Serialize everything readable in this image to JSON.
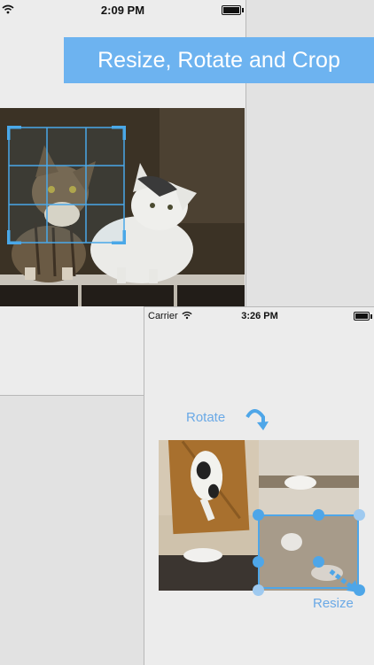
{
  "top_phone": {
    "status_bar": {
      "time": "2:09 PM"
    },
    "banner": {
      "text": "Resize, Rotate and Crop"
    }
  },
  "bottom_phone": {
    "status_bar": {
      "carrier": "Carrier",
      "time": "3:26 PM"
    },
    "rotate_label": "Rotate",
    "resize_label": "Resize"
  },
  "colors": {
    "accent": "#6db3f0",
    "crop_grid": "#4aa8e8",
    "label": "#6aa9e6"
  },
  "crop_grid": {
    "rows": 3,
    "cols": 3
  }
}
